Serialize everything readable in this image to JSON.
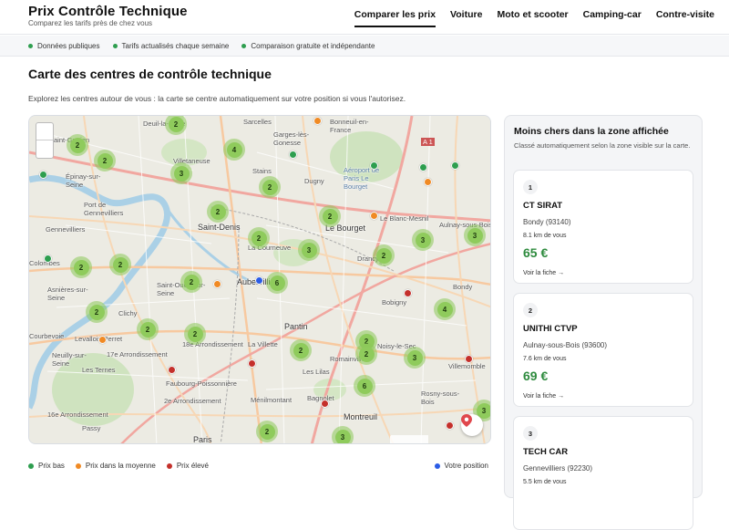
{
  "brand": {
    "title": "Prix Contrôle Technique",
    "subtitle": "Comparez les tarifs près de chez vous"
  },
  "nav": [
    "Comparer les prix",
    "Voiture",
    "Moto et scooter",
    "Camping-car",
    "Contre-visite"
  ],
  "strip": [
    "Données publiques",
    "Tarifs actualisés chaque semaine",
    "Comparaison gratuite et indépendante"
  ],
  "page": {
    "title": "Carte des centres de contrôle technique",
    "description": "Explorez les centres autour de vous : la carte se centre automatiquement sur votre position si vous l'autorisez."
  },
  "map": {
    "places": [
      "Deuil-la-Barre",
      "Sarcelles",
      "Garges-lès-Gonesse",
      "Bonneuil-en-France",
      "Saint-Gratien",
      "Villetaneuse",
      "Stains",
      "Dugny",
      "Épinay-sur-Seine",
      "Port de Gennevilliers",
      "Saint-Denis",
      "Le Bourget",
      "Le Blanc-Mesnil",
      "Aulnay-sous-Bois",
      "Gennevilliers",
      "La Courneuve",
      "Drancy",
      "Colombes",
      "Asnières-sur-Seine",
      "Saint-Ouen-sur-Seine",
      "Aubervilliers",
      "Bobigny",
      "Clichy",
      "Pantin",
      "Courbevoie",
      "Levallois-Perret",
      "17e Arrondissement",
      "18e Arrondissement",
      "La Villette",
      "Noisy-le-Sec",
      "Neuilly-sur-Seine",
      "Les Ternes",
      "Faubourg-Poissonnière",
      "Romainville",
      "Villemomble",
      "Les Lilas",
      "Ménilmontant",
      "Bagnolet",
      "Rosny-sous-Bois",
      "2e Arrondissement",
      "16e Arrondissement",
      "Passy",
      "Paris",
      "Montreuil",
      "Aéroport de Paris Le Bourget",
      "A 1",
      "Bondy"
    ],
    "clusters": [
      "2",
      "2",
      "2",
      "4",
      "3",
      "2",
      "2",
      "2",
      "2",
      "3",
      "3",
      "2",
      "2",
      "3",
      "2",
      "2",
      "2",
      "2",
      "6",
      "4",
      "2",
      "2",
      "2",
      "2",
      "2",
      "3",
      "6",
      "3",
      "3",
      "2",
      "3",
      "3"
    ],
    "you_label": "Votre position"
  },
  "legend": {
    "low": "Prix bas",
    "mid": "Prix dans la moyenne",
    "high": "Prix élevé",
    "you": "Votre position"
  },
  "sidebar": {
    "title": "Moins chers dans la zone affichée",
    "subtitle": "Classé automatiquement selon la zone visible sur la carte.",
    "cards": [
      {
        "rank": "1",
        "name": "CT SIRAT",
        "city": "Bondy (93140)",
        "distance": "8.1 km de vous",
        "price": "65 €",
        "link": "Voir la fiche →"
      },
      {
        "rank": "2",
        "name": "UNITHI CTVP",
        "city": "Aulnay-sous-Bois (93600)",
        "distance": "7.6 km de vous",
        "price": "69 €",
        "link": "Voir la fiche →"
      },
      {
        "rank": "3",
        "name": "TECH CAR",
        "city": "Gennevilliers (92230)",
        "distance": "5.5 km de vous",
        "price": "",
        "link": ""
      }
    ]
  },
  "colors": {
    "low": "#2e9e4f",
    "mid": "#f08a24",
    "high": "#c4302b",
    "you": "#2b5ce6",
    "price": "#2e8b3e"
  }
}
